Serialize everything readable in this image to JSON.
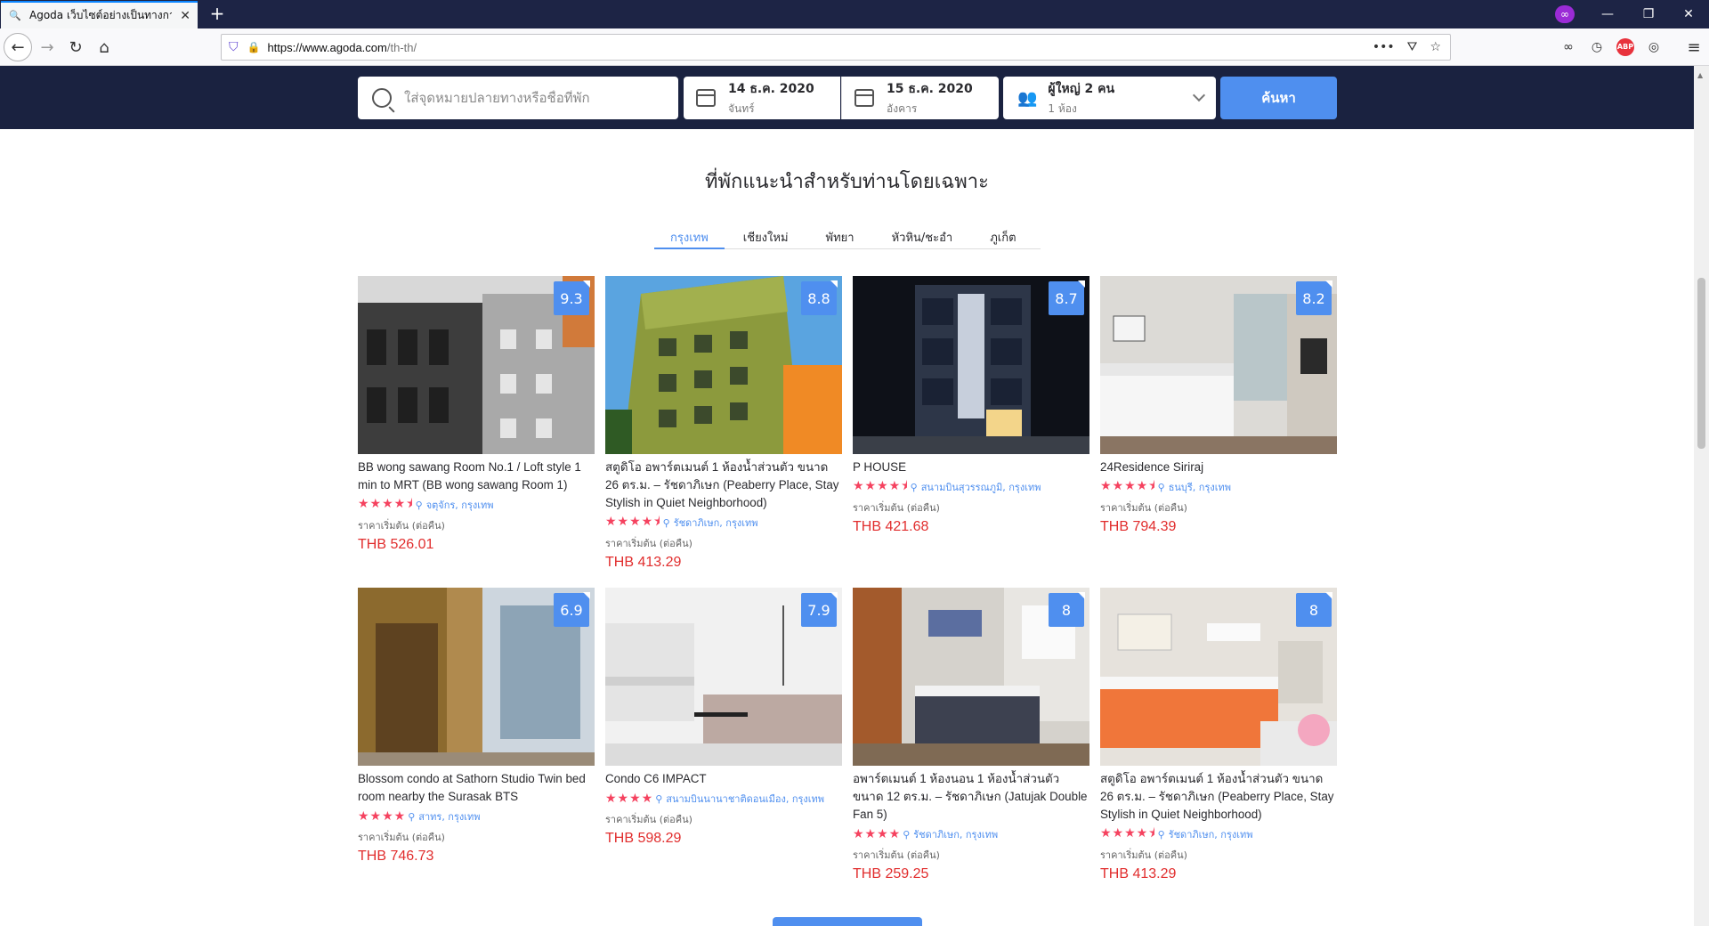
{
  "browser": {
    "tab_title": "Agoda เว็บไซต์อย่างเป็นทางการ",
    "url_host": "https://www.agoda.com",
    "url_path": "/th-th/",
    "window_buttons": [
      "—",
      "❐",
      "✕"
    ]
  },
  "search": {
    "destination_placeholder": "ใส่จุดหมายปลายทางหรือชื่อที่พัก",
    "checkin_date": "14 ธ.ค. 2020",
    "checkin_day": "จันทร์",
    "checkout_date": "15 ธ.ค. 2020",
    "checkout_day": "อังคาร",
    "guests": "ผู้ใหญ่ 2 คน",
    "rooms": "1 ห้อง",
    "button": "ค้นหา"
  },
  "section": {
    "title": "ที่พักแนะนำสำหรับท่านโดยเฉพาะ",
    "cities": [
      "กรุงเทพ",
      "เชียงใหม่",
      "พัทยา",
      "หัวหิน/ชะอำ",
      "ภูเก็ต"
    ]
  },
  "price_from_label": "ราคาเริ่มต้น (ต่อคืน)",
  "properties": [
    {
      "name": "BB wong sawang Room No.1 / Loft style 1 min to MRT (BB wong sawang Room 1)",
      "score": "9.3",
      "stars": "★★★★⯨",
      "location": "จตุจักร, กรุงเทพ",
      "price": "THB 526.01"
    },
    {
      "name": "สตูดิโอ อพาร์ตเมนต์ 1 ห้องน้ำส่วนตัว ขนาด 26 ตร.ม. – รัชดาภิเษก (Peaberry Place, Stay Stylish in Quiet Neighborhood)",
      "score": "8.8",
      "stars": "★★★★⯨",
      "location": "รัชดาภิเษก, กรุงเทพ",
      "price": "THB 413.29"
    },
    {
      "name": "P HOUSE",
      "score": "8.7",
      "stars": "★★★★⯨",
      "location": "สนามบินสุวรรณภูมิ, กรุงเทพ",
      "price": "THB 421.68"
    },
    {
      "name": "24Residence Siriraj",
      "score": "8.2",
      "stars": "★★★★⯨",
      "location": "ธนบุรี, กรุงเทพ",
      "price": "THB 794.39"
    },
    {
      "name": "Blossom condo at Sathorn Studio Twin bed room nearby the Surasak BTS",
      "score": "6.9",
      "stars": "★★★★",
      "location": "สาทร, กรุงเทพ",
      "price": "THB 746.73"
    },
    {
      "name": "Condo C6 IMPACT",
      "score": "7.9",
      "stars": "★★★★",
      "location": "สนามบินนานาชาติดอนเมือง, กรุงเทพ",
      "price": "THB 598.29"
    },
    {
      "name": "อพาร์ตเมนต์ 1 ห้องนอน 1 ห้องน้ำส่วนตัว ขนาด 12 ตร.ม. – รัชดาภิเษก (Jatujak Double Fan 5)",
      "score": "8",
      "stars": "★★★★",
      "location": "รัชดาภิเษก, กรุงเทพ",
      "price": "THB 259.25"
    },
    {
      "name": "สตูดิโอ อพาร์ตเมนต์ 1 ห้องน้ำส่วนตัว ขนาด 26 ตร.ม. – รัชดาภิเษก (Peaberry Place, Stay Stylish in Quiet Neighborhood)",
      "score": "8",
      "stars": "★★★★⯨",
      "location": "รัชดาภิเษก, กรุงเทพ",
      "price": "THB 413.29"
    }
  ],
  "colors": {
    "brand_navy": "#1a2240",
    "accent_blue": "#4f8fef",
    "price_red": "#e12d2d",
    "star_pink": "#f5425f"
  }
}
